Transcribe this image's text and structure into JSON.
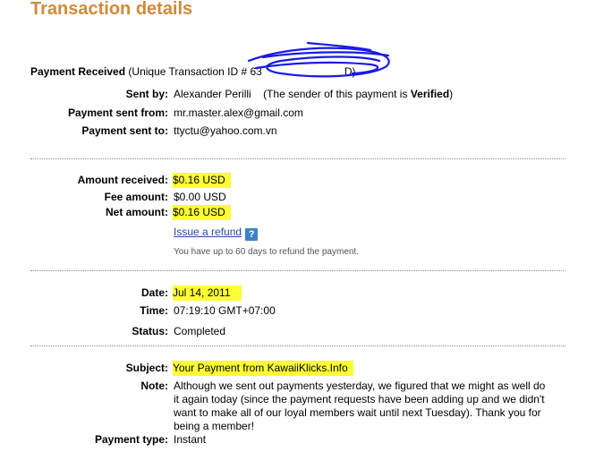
{
  "page": {
    "title": "Transaction details"
  },
  "payment_received": {
    "label": "Payment Received",
    "id_prefix": "(Unique Transaction ID # 63",
    "id_suffix": "D)"
  },
  "sender": {
    "sent_by_label": "Sent by:",
    "name": "Alexander Perilli",
    "status_prefix": "(The sender of this payment is ",
    "status_word": "Verified",
    "status_suffix": ")",
    "from_label": "Payment sent from:",
    "from_value": "mr.master.alex@gmail.com",
    "to_label": "Payment sent to:",
    "to_value": "ttyctu@yahoo.com.vn"
  },
  "amounts": {
    "received_label": "Amount received:",
    "received_value": "$0.16 USD",
    "fee_label": "Fee amount:",
    "fee_value": "$0.00 USD",
    "net_label": "Net amount:",
    "net_value": "$0.16 USD",
    "refund_link": "Issue a refund",
    "help_glyph": "?",
    "refund_note": "You have up to 60 days to refund the payment."
  },
  "timing": {
    "date_label": "Date:",
    "date_value": "Jul 14, 2011",
    "time_label": "Time:",
    "time_value": "07:19:10 GMT+07:00",
    "status_label": "Status:",
    "status_value": "Completed"
  },
  "details": {
    "subject_label": "Subject:",
    "subject_value": "Your Payment from KawaiiKlicks.Info",
    "note_label": "Note:",
    "note_value": "Although we sent out payments yesterday, we figured that we might as well do it again today (since the payment requests have been adding up and we didn't want to make all of our loyal members wait until next Tuesday). Thank you for being a member!",
    "type_label": "Payment type:",
    "type_value": "Instant"
  },
  "colors": {
    "title": "#d08a3a",
    "highlight": "#ffff33",
    "link": "#2a4a9b",
    "help_icon": "#3f83c6",
    "scribble": "#1a1ae6"
  }
}
